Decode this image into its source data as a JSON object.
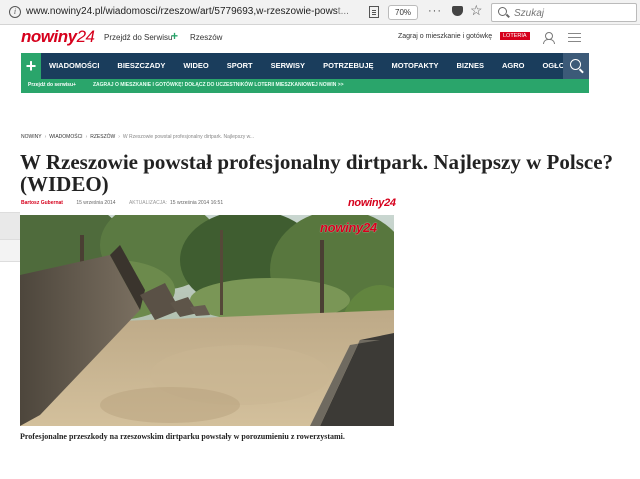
{
  "browser": {
    "url_main": "www.nowiny24.pl/wiadomosci/rzeszow/art/5779693,w-rzeszowie-pows",
    "url_faded": "t...",
    "zoom": "70%",
    "search_placeholder": "Szukaj"
  },
  "header": {
    "logo": "nowiny",
    "logo_num": "24",
    "goto_service": "Przejdź do Serwisu",
    "city": "Rzeszów",
    "promo": "Zagraj o mieszkanie i gotówkę",
    "loteria": "LOTERIA"
  },
  "nav": {
    "items": [
      "WIADOMOŚCI",
      "BIESZCZADY",
      "WIDEO",
      "SPORT",
      "SERWISY",
      "POTRZEBUJĘ",
      "MOTOFAKTY",
      "BIZNES",
      "AGRO",
      "OGŁOSZENIA"
    ]
  },
  "strip": {
    "label": "Przejdź do serwisu+",
    "text": "ZAGRAJ O MIESZKANIE I GOTÓWKĘ! DOŁĄCZ DO UCZESTNIKÓW LOTERII MIESZKANIOWEJ NOWIN >>"
  },
  "breadcrumb": {
    "items": [
      "NOWINY",
      "WIADOMOŚCI",
      "RZESZÓW"
    ],
    "current": "W Rzeszowie powstał profesjonalny dirtpark. Najlepszy w..."
  },
  "article": {
    "title": "W Rzeszowie powstał profesjonalny dirtpark. Najlepszy w Polsce? (WIDEO)",
    "author": "Bartosz Gubernat",
    "date": "15 września 2014",
    "updated_label": "AKTUALIZACJA:",
    "updated": "15 września 2014 16:51",
    "caption": "Profesjonalne przeszkody na rzeszowskim dirtparku powstały w porozumieniu z rowerzystami."
  }
}
